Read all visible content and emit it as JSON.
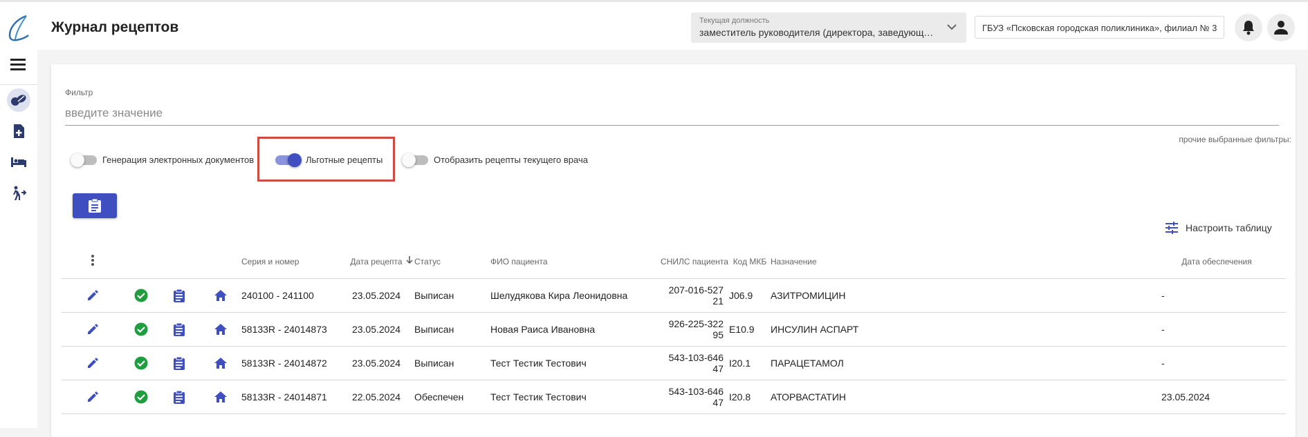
{
  "header": {
    "title": "Журнал рецептов",
    "position_label": "Текущая должность",
    "position_value": "заместитель руководителя (директора, заведующег...",
    "organization": "ГБУЗ «Псковская городская поликлиника», филиал № 3"
  },
  "filter": {
    "label": "Фильтр",
    "placeholder": "введите значение",
    "other_filters": "прочие выбранные фильтры:"
  },
  "toggles": [
    {
      "label": "Генерация электронных документов",
      "on": false
    },
    {
      "label": "Льготные рецепты",
      "on": true
    },
    {
      "label": "Отобразить рецепты текущего врача",
      "on": false
    }
  ],
  "table_settings_label": "Настроить таблицу",
  "table": {
    "headers": {
      "series": "Серия и номер",
      "date": "Дата рецепта",
      "status": "Статус",
      "patient": "ФИО пациента",
      "snils": "СНИЛС пациента",
      "mkb": "Код МКБ",
      "purpose": "Назначение",
      "supply_date": "Дата обеспечения"
    },
    "rows": [
      {
        "series": "240100 - 241100",
        "date": "23.05.2024",
        "status": "Выписан",
        "patient": "Шелудякова Кира Леонидовна",
        "snils": "207-016-527 21",
        "mkb": "J06.9",
        "purpose": "АЗИТРОМИЦИН",
        "supply_date": "-"
      },
      {
        "series": "58133R - 24014873",
        "date": "23.05.2024",
        "status": "Выписан",
        "patient": "Новая Раиса Ивановна",
        "snils": "926-225-322 95",
        "mkb": "E10.9",
        "purpose": "ИНСУЛИН АСПАРТ",
        "supply_date": "-"
      },
      {
        "series": "58133R - 24014872",
        "date": "23.05.2024",
        "status": "Выписан",
        "patient": "Тест Тестик Тестович",
        "snils": "543-103-646 47",
        "mkb": "I20.1",
        "purpose": "ПАРАЦЕТАМОЛ",
        "supply_date": "-"
      },
      {
        "series": "58133R - 24014871",
        "date": "22.05.2024",
        "status": "Обеспечен",
        "patient": "Тест Тестик Тестович",
        "snils": "543-103-646 47",
        "mkb": "I20.8",
        "purpose": "АТОРВАСТАТИН",
        "supply_date": "23.05.2024"
      }
    ]
  },
  "colors": {
    "accent": "#3f4fbf",
    "success": "#1e9e3e",
    "highlight": "#cf4a3f"
  }
}
